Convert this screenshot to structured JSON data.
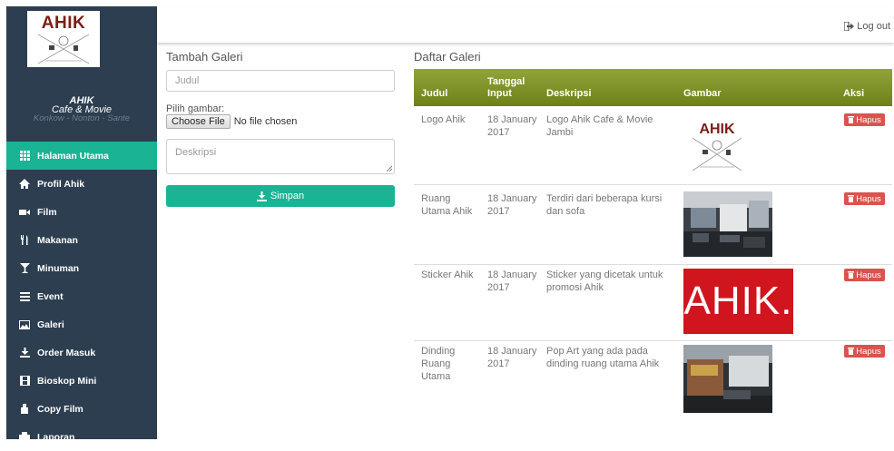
{
  "sidebar": {
    "logo_text": "AHIK",
    "brand_name": "AHIK",
    "brand_sub": "Cafe & Movie",
    "tagline": "Konkow - Nonton - Sante",
    "items": [
      {
        "label": "Halaman Utama",
        "icon": "grid-icon",
        "active": true
      },
      {
        "label": "Profil Ahik",
        "icon": "home-icon"
      },
      {
        "label": "Film",
        "icon": "video-camera-icon"
      },
      {
        "label": "Makanan",
        "icon": "cutlery-icon"
      },
      {
        "label": "Minuman",
        "icon": "glass-icon"
      },
      {
        "label": "Event",
        "icon": "list-icon"
      },
      {
        "label": "Galeri",
        "icon": "picture-icon"
      },
      {
        "label": "Order Masuk",
        "icon": "download-icon"
      },
      {
        "label": "Bioskop Mini",
        "icon": "film-icon"
      },
      {
        "label": "Copy Film",
        "icon": "usb-icon"
      },
      {
        "label": "Laporan",
        "icon": "print-icon"
      }
    ]
  },
  "header": {
    "logout_label": "Log out"
  },
  "form": {
    "title": "Tambah Galeri",
    "judul_placeholder": "Judul",
    "file_label": "Pilih gambar:",
    "file_button": "Choose File",
    "file_status": "No file chosen",
    "deskripsi_placeholder": "Deskripsi",
    "submit_label": "Simpan"
  },
  "table": {
    "title": "Daftar Galeri",
    "headers": {
      "judul": "Judul",
      "tanggal_1": "Tanggal",
      "tanggal_2": "Input",
      "deskripsi": "Deskripsi",
      "gambar": "Gambar",
      "aksi": "Aksi"
    },
    "delete_label": "Hapus",
    "rows": [
      {
        "judul": [
          "Logo Ahik"
        ],
        "tanggal": [
          "18 January",
          "2017"
        ],
        "deskripsi": [
          "Logo Ahik Cafe & Movie",
          "Jambi"
        ],
        "gambar": "logo"
      },
      {
        "judul": [
          "Ruang",
          "Utama Ahik"
        ],
        "tanggal": [
          "18 January",
          "2017"
        ],
        "deskripsi": [
          "Terdiri dari beberapa kursi",
          "dan sofa"
        ],
        "gambar": "room"
      },
      {
        "judul": [
          "Sticker Ahik"
        ],
        "tanggal": [
          "18 January",
          "2017"
        ],
        "deskripsi": [
          "Sticker yang dicetak untuk",
          "promosi Ahik"
        ],
        "gambar": "sticker",
        "sticker_text": "AHIK."
      },
      {
        "judul": [
          "Dinding",
          "Ruang",
          "Utama"
        ],
        "tanggal": [
          "18 January",
          "2017"
        ],
        "deskripsi": [
          "Pop Art yang ada pada",
          "dinding ruang utama Ahik"
        ],
        "gambar": "wall"
      }
    ]
  },
  "colors": {
    "sidebar": "#2c3e50",
    "accent": "#1ab394",
    "table_header": "#7f9228",
    "danger": "#d9534f",
    "sticker_red": "#d0151e"
  }
}
